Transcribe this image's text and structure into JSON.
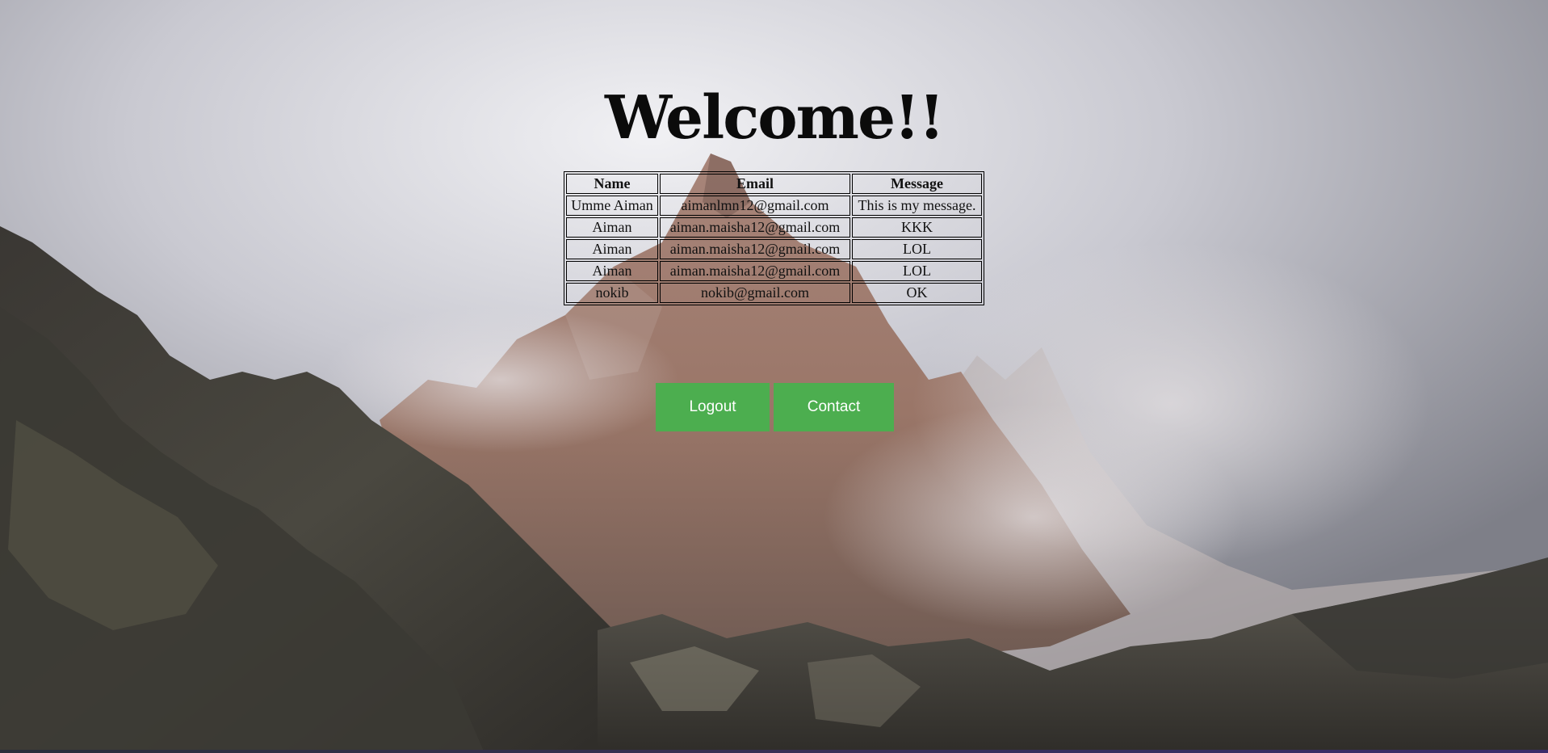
{
  "page": {
    "title": "Welcome!!"
  },
  "table": {
    "headers": {
      "name": "Name",
      "email": "Email",
      "message": "Message"
    },
    "rows": [
      {
        "name": "Umme Aiman",
        "email": "aimanlmn12@gmail.com",
        "message": "This is my message."
      },
      {
        "name": "Aiman",
        "email": "aiman.maisha12@gmail.com",
        "message": "KKK"
      },
      {
        "name": "Aiman",
        "email": "aiman.maisha12@gmail.com",
        "message": "LOL"
      },
      {
        "name": "Aiman",
        "email": "aiman.maisha12@gmail.com",
        "message": "LOL"
      },
      {
        "name": "nokib",
        "email": "nokib@gmail.com",
        "message": "OK"
      }
    ]
  },
  "buttons": {
    "logout_label": "Logout",
    "contact_label": "Contact"
  },
  "colors": {
    "button_green": "#4cae4f",
    "button_text": "#ffffff",
    "title_text": "#0b0b0b"
  }
}
